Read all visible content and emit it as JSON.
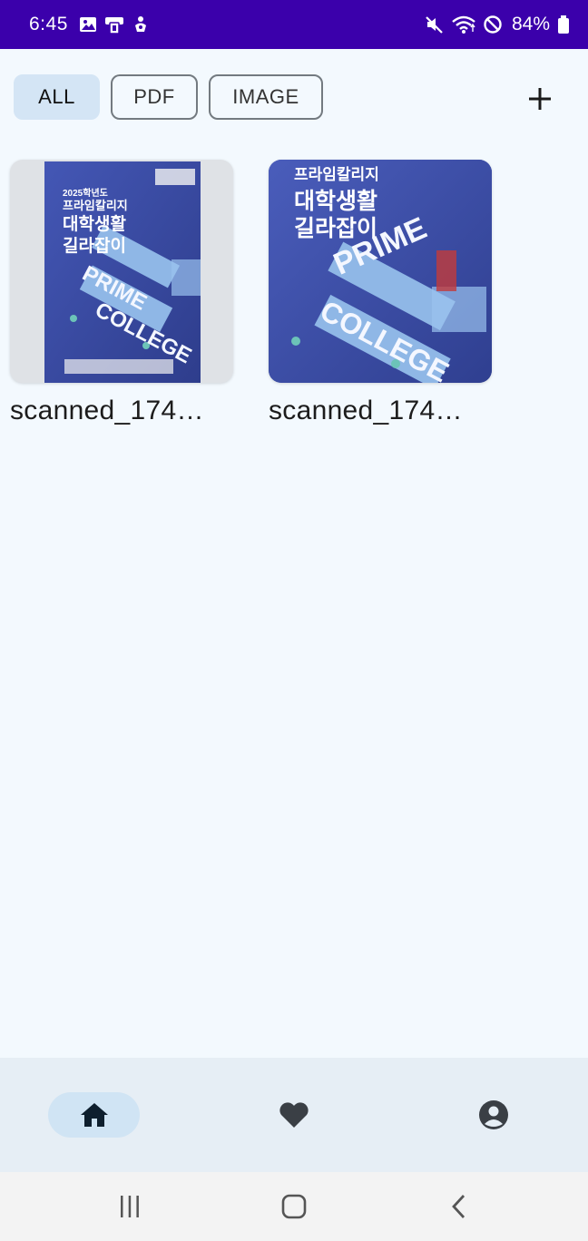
{
  "status_bar": {
    "time": "6:45",
    "battery": "84%",
    "left_icons": [
      "gallery-icon",
      "app-icon",
      "accessibility-icon"
    ],
    "right_icons": [
      "mute-icon",
      "wifi-icon",
      "do-not-disturb-icon",
      "battery-icon"
    ]
  },
  "filters": {
    "items": [
      {
        "label": "ALL",
        "selected": true
      },
      {
        "label": "PDF",
        "selected": false
      },
      {
        "label": "IMAGE",
        "selected": false
      }
    ],
    "add_icon": "plus-icon"
  },
  "documents": [
    {
      "name": "scanned_174…",
      "thumbnail": {
        "brand": "프라임칼리지",
        "year_line": "2025학년도",
        "title_line1": "대학생활",
        "title_line2": "길라잡이",
        "word1": "PRIME",
        "word2": "COLLEGE"
      }
    },
    {
      "name": "scanned_174…",
      "thumbnail": {
        "brand": "프라임칼리지",
        "title_line1": "대학생활",
        "title_line2": "길라잡이",
        "word1": "PRIME",
        "word2": "COLLEGE"
      }
    }
  ],
  "bottom_nav": {
    "items": [
      {
        "icon": "home-icon",
        "selected": true
      },
      {
        "icon": "heart-icon",
        "selected": false
      },
      {
        "icon": "account-icon",
        "selected": false
      }
    ]
  },
  "system_nav": [
    "recents-icon",
    "home-button-icon",
    "back-icon"
  ],
  "colors": {
    "status_bar": "#3b00ab",
    "background": "#f3f9fe",
    "chip_selected": "#d4e5f5",
    "nav_bar": "#e6eef5",
    "cover_blue": "#3d4fa8"
  }
}
